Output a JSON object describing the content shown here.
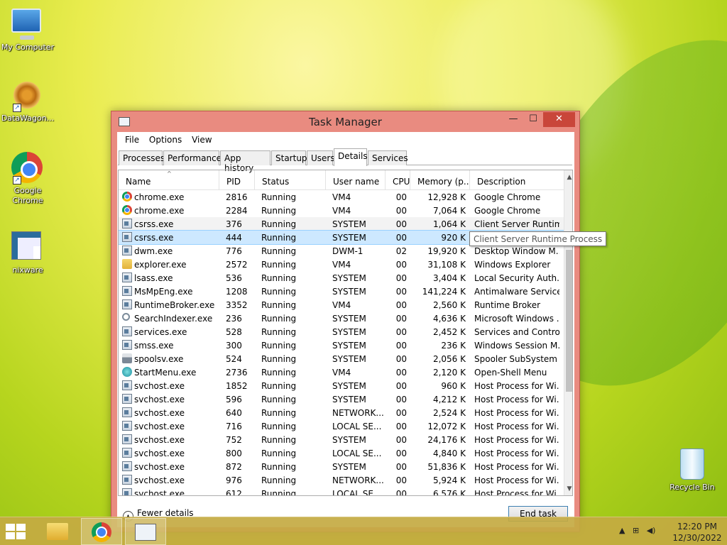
{
  "desktop": {
    "icons": [
      {
        "label": "My Computer"
      },
      {
        "label": "DataWagon..."
      },
      {
        "label": "Google Chrome"
      },
      {
        "label": "nixware"
      },
      {
        "label": "Recycle Bin"
      }
    ]
  },
  "window": {
    "title": "Task Manager",
    "buttons": {
      "minimize": "—",
      "maximize": "☐",
      "close": "✕"
    },
    "menu": [
      "File",
      "Options",
      "View"
    ],
    "tabs": [
      "Processes",
      "Performance",
      "App history",
      "Startup",
      "Users",
      "Details",
      "Services"
    ],
    "active_tab": "Details",
    "columns": [
      "Name",
      "PID",
      "Status",
      "User name",
      "CPU",
      "Memory (p...",
      "Description"
    ],
    "rows": [
      {
        "icon": "chrome-icon",
        "name": "chrome.exe",
        "pid": "2816",
        "status": "Running",
        "user": "VM4",
        "cpu": "00",
        "mem": "12,928 K",
        "desc": "Google Chrome"
      },
      {
        "icon": "chrome-icon",
        "name": "chrome.exe",
        "pid": "2284",
        "status": "Running",
        "user": "VM4",
        "cpu": "00",
        "mem": "7,064 K",
        "desc": "Google Chrome"
      },
      {
        "icon": "window-icon",
        "name": "csrss.exe",
        "pid": "376",
        "status": "Running",
        "user": "SYSTEM",
        "cpu": "00",
        "mem": "1,064 K",
        "desc": "Client Server Runtim..."
      },
      {
        "icon": "window-icon",
        "name": "csrss.exe",
        "pid": "444",
        "status": "Running",
        "user": "SYSTEM",
        "cpu": "00",
        "mem": "920 K",
        "desc": "Client Server Runtime"
      },
      {
        "icon": "window-icon",
        "name": "dwm.exe",
        "pid": "776",
        "status": "Running",
        "user": "DWM-1",
        "cpu": "02",
        "mem": "19,920 K",
        "desc": "Desktop Window M..."
      },
      {
        "icon": "folder-icon",
        "name": "explorer.exe",
        "pid": "2572",
        "status": "Running",
        "user": "VM4",
        "cpu": "00",
        "mem": "31,108 K",
        "desc": "Windows Explorer"
      },
      {
        "icon": "window-icon",
        "name": "lsass.exe",
        "pid": "536",
        "status": "Running",
        "user": "SYSTEM",
        "cpu": "00",
        "mem": "3,404 K",
        "desc": "Local Security Auth..."
      },
      {
        "icon": "window-icon",
        "name": "MsMpEng.exe",
        "pid": "1208",
        "status": "Running",
        "user": "SYSTEM",
        "cpu": "00",
        "mem": "141,224 K",
        "desc": "Antimalware Service..."
      },
      {
        "icon": "window-icon",
        "name": "RuntimeBroker.exe",
        "pid": "3352",
        "status": "Running",
        "user": "VM4",
        "cpu": "00",
        "mem": "2,560 K",
        "desc": "Runtime Broker"
      },
      {
        "icon": "search-icon",
        "name": "SearchIndexer.exe",
        "pid": "236",
        "status": "Running",
        "user": "SYSTEM",
        "cpu": "00",
        "mem": "4,636 K",
        "desc": "Microsoft Windows ..."
      },
      {
        "icon": "window-icon",
        "name": "services.exe",
        "pid": "528",
        "status": "Running",
        "user": "SYSTEM",
        "cpu": "00",
        "mem": "2,452 K",
        "desc": "Services and Control..."
      },
      {
        "icon": "window-icon",
        "name": "smss.exe",
        "pid": "300",
        "status": "Running",
        "user": "SYSTEM",
        "cpu": "00",
        "mem": "236 K",
        "desc": "Windows Session M..."
      },
      {
        "icon": "printer-icon",
        "name": "spoolsv.exe",
        "pid": "524",
        "status": "Running",
        "user": "SYSTEM",
        "cpu": "00",
        "mem": "2,056 K",
        "desc": "Spooler SubSystem ..."
      },
      {
        "icon": "start-menu-icon",
        "name": "StartMenu.exe",
        "pid": "2736",
        "status": "Running",
        "user": "VM4",
        "cpu": "00",
        "mem": "2,120 K",
        "desc": "Open-Shell Menu"
      },
      {
        "icon": "window-icon",
        "name": "svchost.exe",
        "pid": "1852",
        "status": "Running",
        "user": "SYSTEM",
        "cpu": "00",
        "mem": "960 K",
        "desc": "Host Process for Wi..."
      },
      {
        "icon": "window-icon",
        "name": "svchost.exe",
        "pid": "596",
        "status": "Running",
        "user": "SYSTEM",
        "cpu": "00",
        "mem": "4,212 K",
        "desc": "Host Process for Wi..."
      },
      {
        "icon": "window-icon",
        "name": "svchost.exe",
        "pid": "640",
        "status": "Running",
        "user": "NETWORK...",
        "cpu": "00",
        "mem": "2,524 K",
        "desc": "Host Process for Wi..."
      },
      {
        "icon": "window-icon",
        "name": "svchost.exe",
        "pid": "716",
        "status": "Running",
        "user": "LOCAL SE...",
        "cpu": "00",
        "mem": "12,072 K",
        "desc": "Host Process for Wi..."
      },
      {
        "icon": "window-icon",
        "name": "svchost.exe",
        "pid": "752",
        "status": "Running",
        "user": "SYSTEM",
        "cpu": "00",
        "mem": "24,176 K",
        "desc": "Host Process for Wi..."
      },
      {
        "icon": "window-icon",
        "name": "svchost.exe",
        "pid": "800",
        "status": "Running",
        "user": "LOCAL SE...",
        "cpu": "00",
        "mem": "4,840 K",
        "desc": "Host Process for Wi..."
      },
      {
        "icon": "window-icon",
        "name": "svchost.exe",
        "pid": "872",
        "status": "Running",
        "user": "SYSTEM",
        "cpu": "00",
        "mem": "51,836 K",
        "desc": "Host Process for Wi..."
      },
      {
        "icon": "window-icon",
        "name": "svchost.exe",
        "pid": "976",
        "status": "Running",
        "user": "NETWORK...",
        "cpu": "00",
        "mem": "5,924 K",
        "desc": "Host Process for Wi..."
      },
      {
        "icon": "window-icon",
        "name": "svchost.exe",
        "pid": "612",
        "status": "Running",
        "user": "LOCAL SE...",
        "cpu": "00",
        "mem": "6,576 K",
        "desc": "Host Process for Wi..."
      }
    ],
    "selected_row": 3,
    "tooltip": "Client Server Runtime Process",
    "footer": {
      "fewer_details": "Fewer details",
      "end_task": "End task"
    }
  },
  "taskbar": {
    "clock_time": "12:20 PM",
    "clock_date": "12/30/2022",
    "tray_icons": [
      "show-hidden-icon",
      "network-icon",
      "volume-icon"
    ]
  },
  "colors": {
    "window_frame": "#e98b80",
    "close_button": "#c9463a",
    "selection": "#cde8ff",
    "taskbar": "#c4aa42"
  }
}
